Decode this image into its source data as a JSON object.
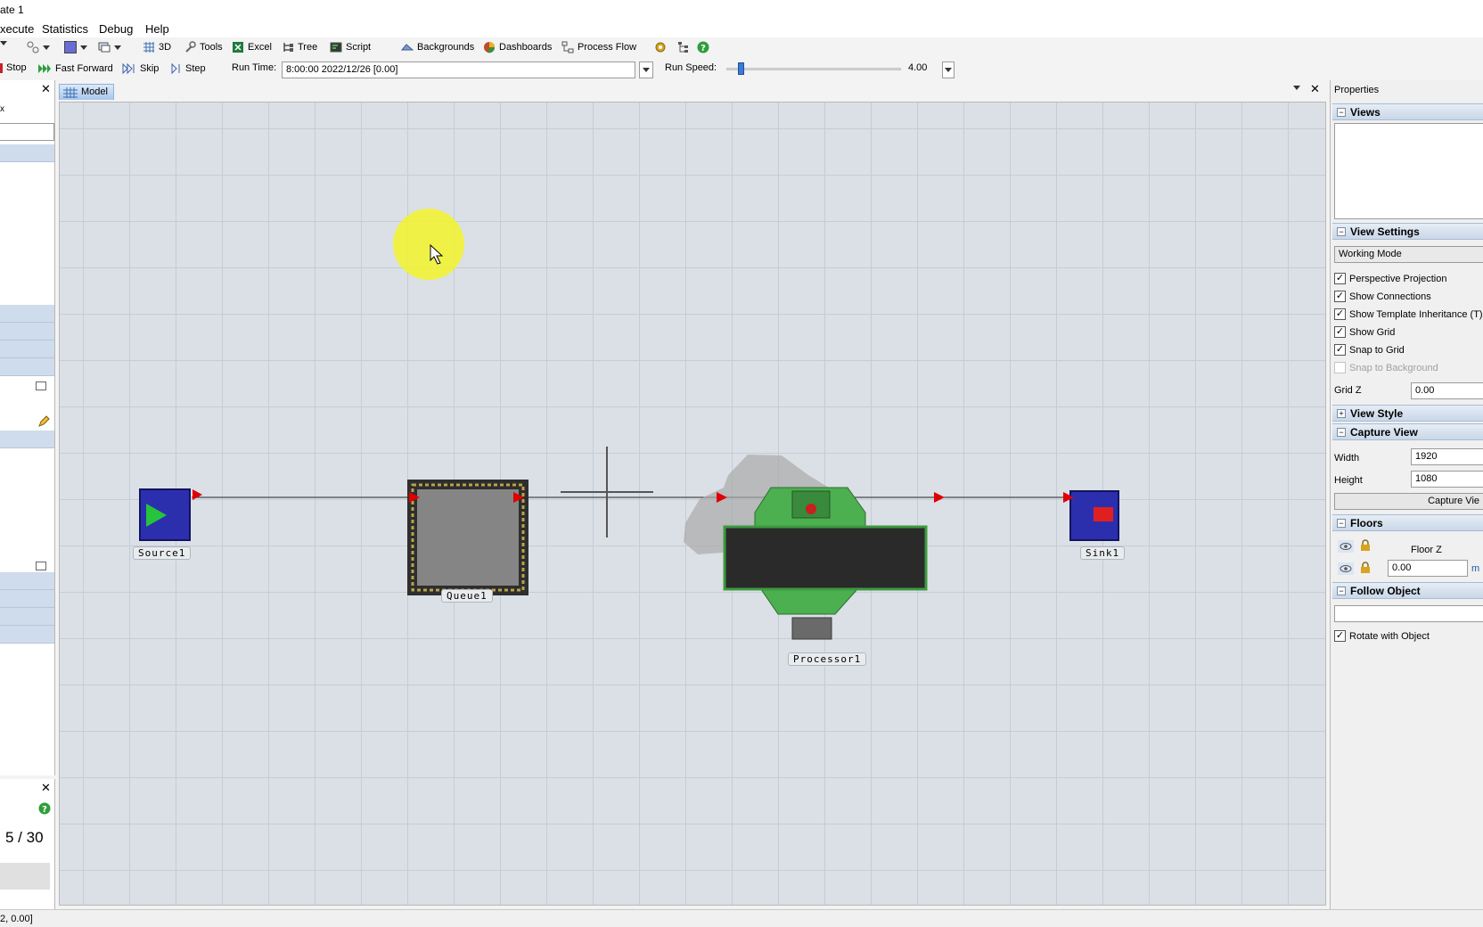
{
  "title": "ate 1",
  "menu": [
    "xecute",
    "Statistics",
    "Debug",
    "Help"
  ],
  "toolbar": {
    "view3d": "3D",
    "tools": "Tools",
    "excel": "Excel",
    "tree": "Tree",
    "script": "Script",
    "backgrounds": "Backgrounds",
    "dashboards": "Dashboards",
    "process_flow": "Process Flow"
  },
  "run_bar": {
    "stop": "Stop",
    "fast_forward": "Fast Forward",
    "skip": "Skip",
    "step": "Step",
    "run_time_label": "Run Time:",
    "run_time_value": "8:00:00  2022/12/26  [0.00]",
    "run_speed_label": "Run Speed:",
    "run_speed_value": "4.00"
  },
  "left_panel": {
    "lower_counter": "5 / 30"
  },
  "model": {
    "tab_label": "Model",
    "objects": {
      "source": "Source1",
      "queue": "Queue1",
      "processor": "Processor1",
      "sink": "Sink1"
    }
  },
  "properties": {
    "title": "Properties",
    "views": "Views",
    "view_settings": "View Settings",
    "working_mode": "Working Mode",
    "checkboxes": [
      {
        "label": "Perspective Projection",
        "checked": true
      },
      {
        "label": "Show Connections",
        "checked": true
      },
      {
        "label": "Show Template Inheritance (T)",
        "checked": true
      },
      {
        "label": "Show Grid",
        "checked": true
      },
      {
        "label": "Snap to Grid",
        "checked": true
      },
      {
        "label": "Snap to Background",
        "checked": false
      }
    ],
    "grid_z_label": "Grid Z",
    "grid_z_value": "0.00",
    "view_style": "View Style",
    "capture_view": "Capture View",
    "width_label": "Width",
    "width_value": "1920",
    "height_label": "Height",
    "height_value": "1080",
    "capture_button": "Capture Vie",
    "floors": "Floors",
    "floor_z_label": "Floor Z",
    "floor_z_value": "0.00",
    "floor_unit": "m",
    "follow_object": "Follow Object",
    "rotate_with_object": "Rotate with Object"
  },
  "status": "2, 0.00]",
  "colors": {
    "accent": "#3a7bd5",
    "grid_bg": "#dbe0e6",
    "arrow_red": "#e00000",
    "processor_green": "#4caf50"
  }
}
